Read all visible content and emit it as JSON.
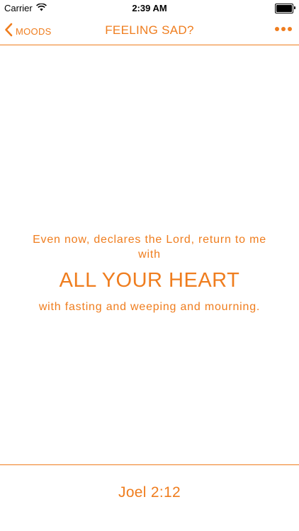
{
  "status_bar": {
    "carrier": "Carrier",
    "time": "2:39 AM",
    "battery_level": 1.0
  },
  "nav": {
    "back_label": "MOODS",
    "title": "FEELING SAD?"
  },
  "verse": {
    "line1": "Even now, declares the Lord, return to me with",
    "emphasis": "ALL YOUR HEART",
    "line2": "with fasting and weeping and mourning."
  },
  "reference": "Joel 2:12",
  "colors": {
    "accent": "#ef7d1e",
    "background": "#ffffff"
  },
  "icons": {
    "wifi": "wifi-icon",
    "battery": "battery-icon",
    "back": "chevron-left-icon",
    "more": "more-dots-icon"
  }
}
